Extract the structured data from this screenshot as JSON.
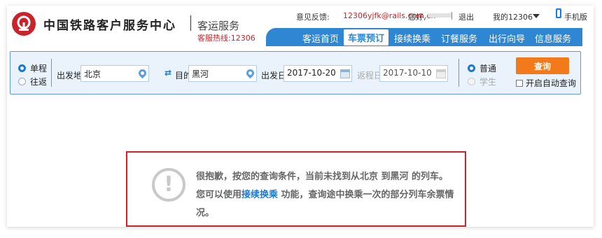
{
  "header": {
    "brand": "中国铁路客户服务中心",
    "subtitle": "客运服务",
    "hotline": "客服热线:12306",
    "feedback_label": "意见反馈:",
    "feedback_email": "12306yjfk@rails.com.cn",
    "greeting": "您好,",
    "logout": "退出",
    "my_account": "我的12306",
    "mobile": "手机版"
  },
  "nav": {
    "items": [
      {
        "label": "客运首页"
      },
      {
        "label": "车票预订"
      },
      {
        "label": "接续换乘"
      },
      {
        "label": "订餐服务"
      },
      {
        "label": "出行向导"
      },
      {
        "label": "信息服务"
      }
    ]
  },
  "search": {
    "trip_type": {
      "one_way": "单程",
      "round_trip": "往返",
      "selected": "单程"
    },
    "from_label": "出发地",
    "from_value": "北京",
    "to_label": "目的地",
    "to_value": "黑河",
    "depart_label": "出发日",
    "depart_value": "2017-10-20",
    "return_label": "返程日",
    "return_value": "2017-10-10",
    "ticket_type": {
      "normal": "普通",
      "student": "学生",
      "selected": "普通"
    },
    "query_button": "查询",
    "auto_query_label": "开启自动查询"
  },
  "message": {
    "text_before": "很抱歉，按您的查询条件，当前未找到从北京 到黑河 的列车。您可以使用",
    "link": "接续换乘",
    "text_after": " 功能，查询途中换乘一次的部分列车余票情况。"
  },
  "colors": {
    "brand_red": "#c8242c",
    "nav_blue": "#2f86d3",
    "query_orange": "#f27a1a"
  }
}
